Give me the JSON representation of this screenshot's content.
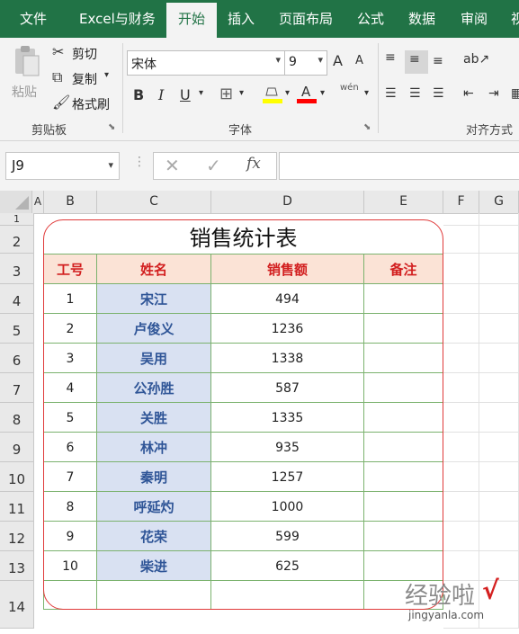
{
  "menu": {
    "tabs": [
      "文件",
      "Excel与财务",
      "开始",
      "插入",
      "页面布局",
      "公式",
      "数据",
      "审阅",
      "视"
    ],
    "active": "开始"
  },
  "ribbon": {
    "clipboard": {
      "paste": "粘贴",
      "cut": "剪切",
      "copy": "复制",
      "format_painter": "格式刷",
      "label": "剪贴板"
    },
    "font": {
      "name": "宋体",
      "size": "9",
      "label": "字体",
      "bold": "B",
      "italic": "I",
      "underline": "U",
      "grow": "A",
      "shrink": "A",
      "wen": "wén"
    },
    "alignment": {
      "label": "对齐方式"
    }
  },
  "formula_bar": {
    "name_box": "J9",
    "fx": "fx",
    "formula": ""
  },
  "columns": [
    "A",
    "B",
    "C",
    "D",
    "E",
    "F",
    "G"
  ],
  "rows": [
    "1",
    "2",
    "3",
    "4",
    "5",
    "6",
    "7",
    "8",
    "9",
    "10",
    "11",
    "12",
    "13",
    "14"
  ],
  "sheet": {
    "title": "销售统计表",
    "headers": [
      "工号",
      "姓名",
      "销售额",
      "备注"
    ],
    "records": [
      {
        "id": "1",
        "name": "宋江",
        "sales": "494",
        "note": ""
      },
      {
        "id": "2",
        "name": "卢俊义",
        "sales": "1236",
        "note": ""
      },
      {
        "id": "3",
        "name": "吴用",
        "sales": "1338",
        "note": ""
      },
      {
        "id": "4",
        "name": "公孙胜",
        "sales": "587",
        "note": ""
      },
      {
        "id": "5",
        "name": "关胜",
        "sales": "1335",
        "note": ""
      },
      {
        "id": "6",
        "name": "林冲",
        "sales": "935",
        "note": ""
      },
      {
        "id": "7",
        "name": "秦明",
        "sales": "1257",
        "note": ""
      },
      {
        "id": "8",
        "name": "呼延灼",
        "sales": "1000",
        "note": ""
      },
      {
        "id": "9",
        "name": "花荣",
        "sales": "599",
        "note": ""
      },
      {
        "id": "10",
        "name": "柴进",
        "sales": "625",
        "note": ""
      }
    ]
  },
  "watermark": {
    "text": "经验啦",
    "check": "√",
    "url": "jingyanla.com"
  },
  "colors": {
    "excel_green": "#217346",
    "header_fill": "#fbe3d6",
    "header_text": "#d21f1f",
    "name_fill": "#d9e1f2",
    "name_text": "#2f5597",
    "grid_green": "#7bb26e",
    "frame_red": "#e03a3a"
  }
}
